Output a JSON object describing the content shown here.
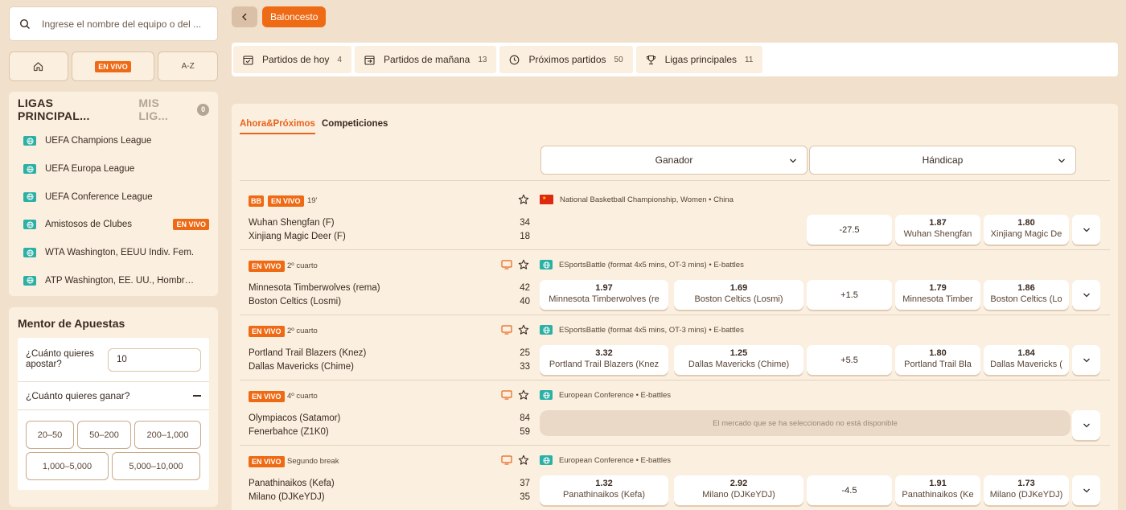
{
  "search": {
    "placeholder": "Ingrese el nombre del equipo o del ..."
  },
  "quicknav": {
    "live_label": "EN VIVO",
    "az_label": "A-Z"
  },
  "leagues_panel": {
    "tab_main": "LIGAS PRINCIPAL...",
    "tab_mine": "MIS LIG...",
    "mine_count": "0",
    "items": [
      {
        "label": "UEFA Champions League",
        "live": ""
      },
      {
        "label": "UEFA Europa League",
        "live": ""
      },
      {
        "label": "UEFA Conference League",
        "live": ""
      },
      {
        "label": "Amistosos de Clubes",
        "live": "EN VIVO"
      },
      {
        "label": "WTA Washington, EEUU Indiv. Fem.",
        "live": ""
      },
      {
        "label": "ATP Washington, EE. UU., Hombres ...",
        "live": ""
      }
    ]
  },
  "mentor": {
    "title": "Mentor de Apuestas",
    "stake_question": "¿Cuánto quieres apostar?",
    "stake_value": "10",
    "win_question": "¿Cuánto quieres ganar?",
    "ranges": [
      "20–50",
      "50–200",
      "200–1,000",
      "1,000–5,000",
      "5,000–10,000"
    ]
  },
  "header": {
    "sport": "Baloncesto"
  },
  "top_tabs": [
    {
      "label": "Partidos de hoy",
      "count": "4",
      "icon": "calendar-check-icon"
    },
    {
      "label": "Partidos de mañana",
      "count": "13",
      "icon": "calendar-next-icon"
    },
    {
      "label": "Próximos partidos",
      "count": "50",
      "icon": "clock-icon"
    },
    {
      "label": "Ligas principales",
      "count": "11",
      "icon": "trophy-icon"
    }
  ],
  "subtabs": {
    "active": "Ahora&Próximos",
    "other": "Competiciones"
  },
  "markets": {
    "winner": "Ganador",
    "handicap": "Hándicap"
  },
  "matches": [
    {
      "sport_badge": "BB",
      "live": "EN VIVO",
      "time": "19'",
      "league": "National Basketball Championship, Women • China",
      "home": "Wuhan Shengfan (F)",
      "away": "Xinjiang Magic Deer (F)",
      "home_score": "34",
      "away_score": "18",
      "win_home": {
        "odd": "",
        "name": ""
      },
      "win_away": {
        "odd": "",
        "name": ""
      },
      "handicap": "-27.5",
      "hc_home": {
        "odd": "1.87",
        "name": "Wuhan Shengfan"
      },
      "hc_away": {
        "odd": "1.80",
        "name": "Xinjiang Magic De"
      }
    },
    {
      "live": "EN VIVO",
      "time": "2º cuarto",
      "league": "ESportsBattle (format 4x5 mins, OT-3 mins) • E-battles",
      "home": "Minnesota Timberwolves (rema)",
      "away": "Boston Celtics (Losmi)",
      "home_score": "42",
      "away_score": "40",
      "win_home": {
        "odd": "1.97",
        "name": "Minnesota Timberwolves (re"
      },
      "win_away": {
        "odd": "1.69",
        "name": "Boston Celtics (Losmi)"
      },
      "handicap": "+1.5",
      "hc_home": {
        "odd": "1.79",
        "name": "Minnesota Timber"
      },
      "hc_away": {
        "odd": "1.86",
        "name": "Boston Celtics (Lo"
      }
    },
    {
      "live": "EN VIVO",
      "time": "2º cuarto",
      "league": "ESportsBattle (format 4x5 mins, OT-3 mins) • E-battles",
      "home": "Portland Trail Blazers (Knez)",
      "away": "Dallas Mavericks (Chime)",
      "home_score": "25",
      "away_score": "33",
      "win_home": {
        "odd": "3.32",
        "name": "Portland Trail Blazers (Knez"
      },
      "win_away": {
        "odd": "1.25",
        "name": "Dallas Mavericks (Chime)"
      },
      "handicap": "+5.5",
      "hc_home": {
        "odd": "1.80",
        "name": "Portland Trail Bla"
      },
      "hc_away": {
        "odd": "1.84",
        "name": "Dallas Mavericks ("
      }
    },
    {
      "live": "EN VIVO",
      "time": "4º cuarto",
      "league": "European Conference • E-battles",
      "home": "Olympiacos (Satamor)",
      "away": "Fenerbahce (Z1K0)",
      "home_score": "84",
      "away_score": "59",
      "unavailable": "El mercado que se ha seleccionado no está disponible"
    },
    {
      "live": "EN VIVO",
      "time": "Segundo break",
      "league": "European Conference • E-battles",
      "home": "Panathinaikos (Kefa)",
      "away": "Milano (DJKeYDJ)",
      "home_score": "37",
      "away_score": "35",
      "win_home": {
        "odd": "1.32",
        "name": "Panathinaikos (Kefa)"
      },
      "win_away": {
        "odd": "2.92",
        "name": "Milano (DJKeYDJ)"
      },
      "handicap": "-4.5",
      "hc_home": {
        "odd": "1.91",
        "name": "Panathinaikos (Ke"
      },
      "hc_away": {
        "odd": "1.73",
        "name": "Milano (DJKeYDJ)"
      }
    }
  ]
}
